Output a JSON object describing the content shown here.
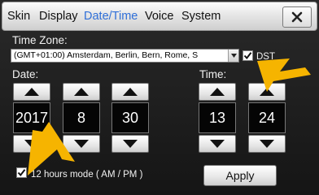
{
  "tabs": [
    {
      "label": "Skin"
    },
    {
      "label": "Display"
    },
    {
      "label": "Date/Time"
    },
    {
      "label": "Voice"
    },
    {
      "label": "System"
    }
  ],
  "active_tab": "Date/Time",
  "timezone": {
    "label": "Time Zone:",
    "selected": "(GMT+01:00) Amsterdam, Berlin, Bern, Rome, S"
  },
  "dst": {
    "label": "DST",
    "checked": true
  },
  "date": {
    "label": "Date:",
    "year": "2017",
    "month": "8",
    "day": "30"
  },
  "time": {
    "label": "Time:",
    "hour": "13",
    "minute": "24"
  },
  "hours12": {
    "label": "12 hours mode ( AM / PM )",
    "checked": true
  },
  "apply_label": "Apply",
  "colors": {
    "active_tab": "#2f6fd8",
    "annotation_arrow": "#f6b400",
    "value_box": "#050505"
  },
  "icons": [
    "close-icon",
    "dropdown-arrow-icon",
    "checkmark-icon",
    "up-arrow-icon",
    "down-arrow-icon"
  ]
}
